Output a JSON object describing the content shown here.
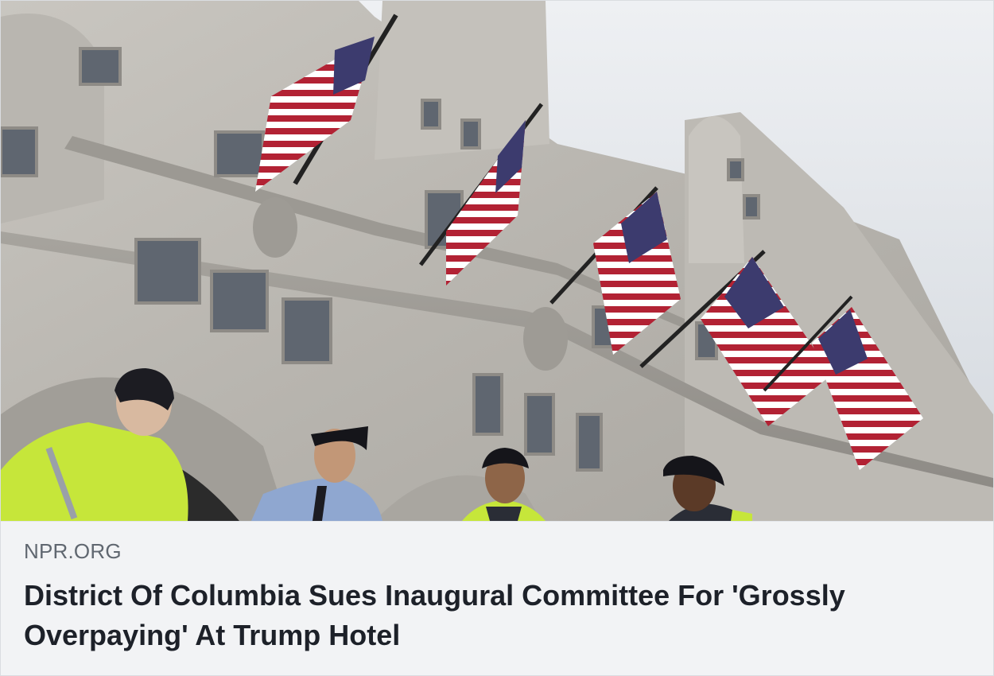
{
  "link_preview": {
    "domain": "NPR.ORG",
    "headline": "District Of Columbia Sues Inaugural Committee For 'Grossly Overpaying' At Trump Hotel",
    "image": {
      "subject": "building-with-flags-and-police-officers"
    }
  },
  "colors": {
    "card_background": "#f2f3f5",
    "domain_text": "#606770",
    "headline_text": "#1d2129",
    "flag_red": "#b22234",
    "flag_blue": "#3c3b6e",
    "officer_jacket": "#c6e63a"
  }
}
